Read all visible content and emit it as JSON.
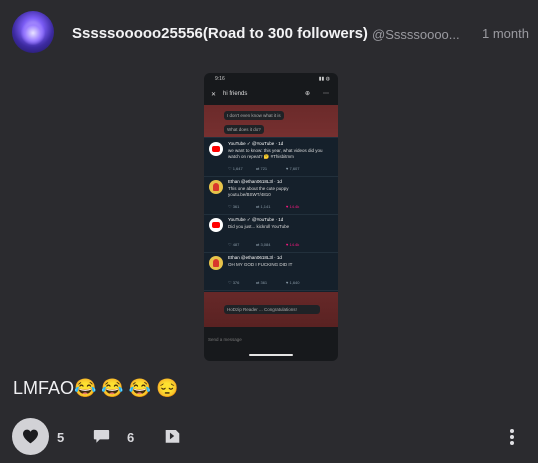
{
  "post": {
    "username": "Sssssooooo25556(Road to 300 followers)",
    "handle": "@Sssssoooo...",
    "time_ago": "1 month",
    "caption": "LMFAO😂 😂 😂 😔",
    "likes": "5",
    "comments": "6"
  },
  "screenshot": {
    "status_time": "9:16",
    "chat_title": "hi friends",
    "bubble1": "I don't even know what it is",
    "bubble2": "What does it do?",
    "bubble3": "HoDzip Reader ... Congratulations!",
    "input_placeholder": "Send a message",
    "tweets": [
      {
        "name": "YouTube ✓ @YouTube · 1d",
        "text": "we want to know: this year, what videos did you watch on repeat? 🤔 #Thisbitmm",
        "a": "1,647",
        "b": "721",
        "c": "7,607"
      },
      {
        "name": "Ethan @ethan0618L3l · 1d",
        "text": "This one about the cute puppy youtu.be/BSWT/4810",
        "a": "361",
        "b": "1,141",
        "c": "14.4k"
      },
      {
        "name": "YouTube ✓ @YouTube · 1d",
        "text": "Did you just... kickroll YouTube",
        "a": "487",
        "b": "3,084",
        "c": "14.4k"
      },
      {
        "name": "Ethan @ethan0618L3l · 1d",
        "text": "OH MY GOD I FUCKING DID IT",
        "a": "376",
        "b": "361",
        "c": "1,640"
      }
    ]
  },
  "icons": {
    "like": "heart-icon",
    "comment": "comment-icon",
    "share": "share-icon",
    "more": "more-vertical-icon"
  },
  "colors": {
    "background": "#2b2b2f",
    "like_button_bg": "#d2d2d6"
  }
}
